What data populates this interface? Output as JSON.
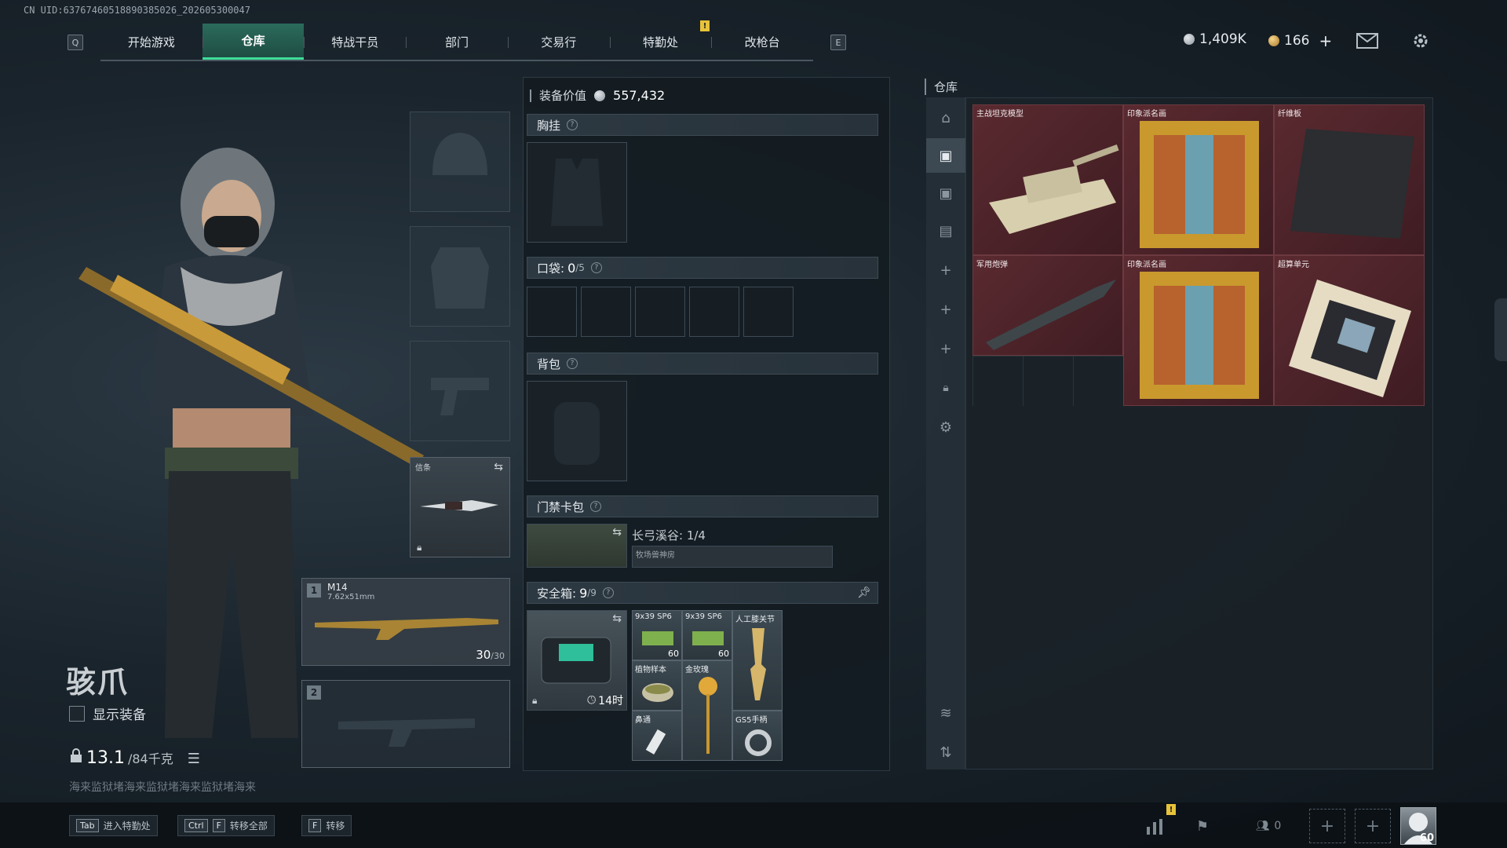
{
  "uid": "CN UID:63767460518890385026_202605300047",
  "nav": {
    "left_key": "Q",
    "right_key": "E",
    "items": [
      {
        "label": "开始游戏"
      },
      {
        "label": "仓库",
        "active": true
      },
      {
        "label": "特战干员"
      },
      {
        "label": "部门"
      },
      {
        "label": "交易行"
      },
      {
        "label": "特勤处"
      },
      {
        "label": "改枪台"
      }
    ],
    "alert": "!"
  },
  "currency": {
    "silver": "1,409K",
    "gold": "166",
    "gold_add": "+"
  },
  "character": {
    "name": "骇爪",
    "show_equipment": "显示装备",
    "weight_value": "13.1",
    "weight_max": "/84千克",
    "flavor": "海来监狱堵海来监狱堵海来监狱堵海来"
  },
  "melee": {
    "label": "信条"
  },
  "weapons": [
    {
      "slot": "1",
      "name": "M14",
      "caliber": "7.62x51mm",
      "ammo": "30",
      "ammo_max": "/30"
    },
    {
      "slot": "2",
      "name": "",
      "caliber": "",
      "ammo": "",
      "ammo_max": ""
    }
  ],
  "loadout": {
    "value_label": "装备价值",
    "value": "557,432",
    "chest_rig": "胸挂",
    "pockets_label": "口袋:",
    "pockets_value": "0",
    "pockets_max": "/5",
    "backpack": "背包",
    "keycard": "门禁卡包",
    "keycard_map": "长弓溪谷: 1/4",
    "keycard_item": "牧场兽神房",
    "safebox_label": "安全箱:",
    "safebox_value": "9",
    "safebox_max": "/9",
    "safebox_timer": "14时"
  },
  "safebox_items": [
    {
      "label": "9x39 SP6",
      "qty": "60"
    },
    {
      "label": "9x39 SP6",
      "qty": "60"
    },
    {
      "label": "人工膝关节",
      "qty": ""
    },
    {
      "label": "植物样本",
      "qty": ""
    },
    {
      "label": "金玫瑰",
      "qty": ""
    },
    {
      "label": "",
      "qty": ""
    },
    {
      "label": "鼻通",
      "qty": ""
    },
    {
      "label": "",
      "qty": ""
    },
    {
      "label": "GS5手柄",
      "qty": ""
    }
  ],
  "stash": {
    "title": "仓库",
    "items": [
      {
        "label": "主战坦克模型"
      },
      {
        "label": "印象派名画"
      },
      {
        "label": "纤维板"
      },
      {
        "label": "军用炮弹"
      },
      {
        "label": "印象派名画"
      },
      {
        "label": "超算单元"
      }
    ]
  },
  "bottom": {
    "hint1_key": "Tab",
    "hint1": "进入特勤处",
    "hint2_key1": "Ctrl",
    "hint2_key2": "F",
    "hint2": "转移全部",
    "hint3_key": "F",
    "hint3": "转移",
    "friends": "0",
    "level": "60"
  },
  "colors": {
    "accent": "#3ddc97",
    "stash_cell": "#5a2a30",
    "alert": "#e7c23a"
  }
}
